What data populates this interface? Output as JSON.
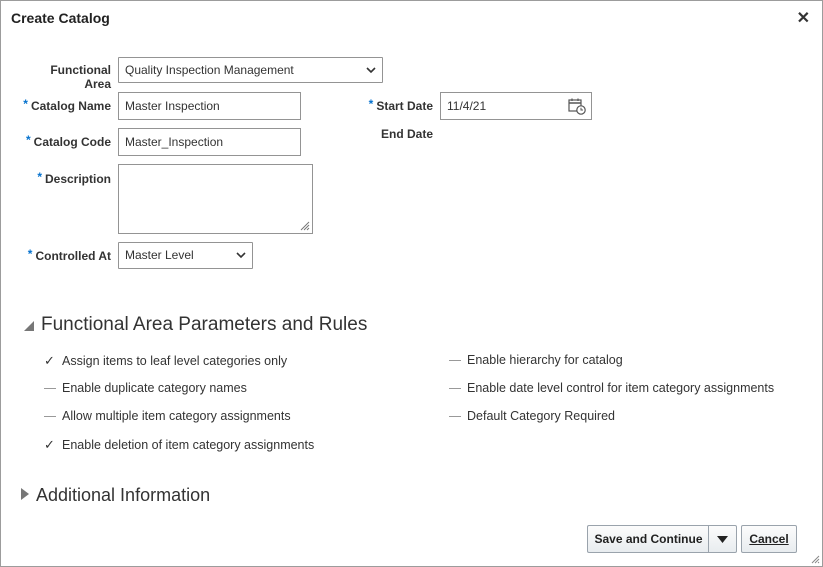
{
  "dialog": {
    "title": "Create Catalog",
    "close_icon": "close-icon"
  },
  "form": {
    "functional_area": {
      "label": "Functional Area",
      "value": "Quality Inspection Management"
    },
    "catalog_name": {
      "label": "Catalog Name",
      "value": "Master Inspection",
      "required": true
    },
    "catalog_code": {
      "label": "Catalog Code",
      "value": "Master_Inspection",
      "required": true
    },
    "description": {
      "label": "Description",
      "value": "",
      "required": true
    },
    "controlled_at": {
      "label": "Controlled At",
      "value": "Master Level",
      "required": true
    },
    "start_date": {
      "label": "Start Date",
      "value": "11/4/21",
      "required": true
    },
    "end_date": {
      "label": "End Date",
      "value": ""
    }
  },
  "params_section": {
    "title": "Functional Area Parameters and Rules",
    "expanded": true,
    "left": [
      {
        "label": "Assign items to leaf level categories only",
        "checked": true
      },
      {
        "label": "Enable duplicate category names",
        "checked": false
      },
      {
        "label": "Allow multiple item category assignments",
        "checked": false
      },
      {
        "label": "Enable deletion of item category assignments",
        "checked": true
      }
    ],
    "right": [
      {
        "label": "Enable hierarchy for catalog",
        "checked": false
      },
      {
        "label": "Enable date level control for item category assignments",
        "checked": false
      },
      {
        "label": "Default Category Required",
        "checked": false
      }
    ]
  },
  "additional_section": {
    "title": "Additional Information",
    "expanded": false
  },
  "buttons": {
    "save_continue": "Save and Continue",
    "cancel": "Cancel"
  },
  "required_mark": "*",
  "colors": {
    "required": "#0572ce",
    "border": "#949494"
  }
}
